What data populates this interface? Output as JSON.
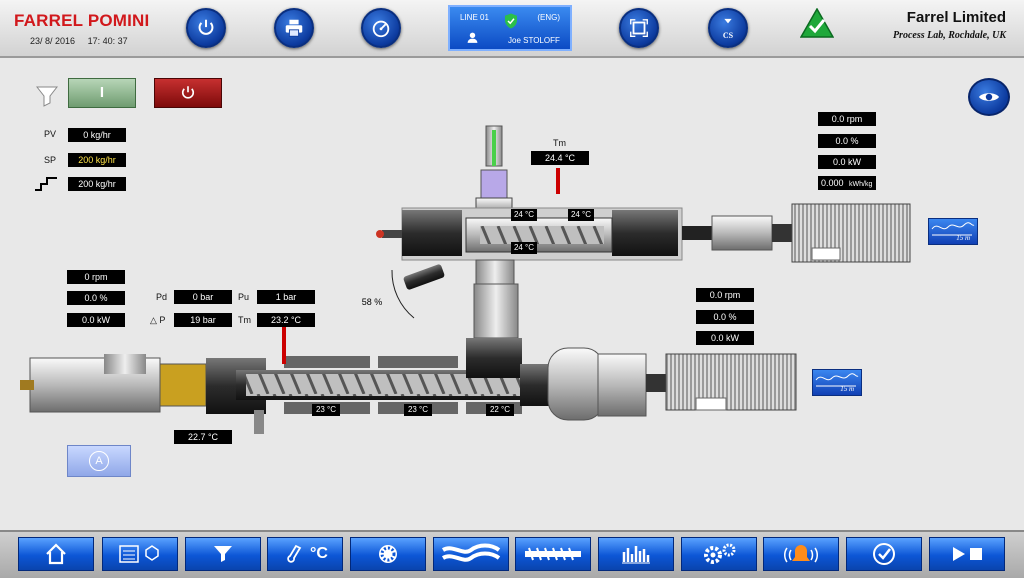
{
  "header": {
    "brand": "FARREL POMINI",
    "date": "23/ 8/ 2016",
    "time": "17: 40: 37",
    "line": "LINE 01",
    "lang": "(ENG)",
    "user": "Joe STOLOFF",
    "company": "Farrel Limited",
    "location": "Process Lab, Rochdale, UK",
    "icons": [
      "power-icon",
      "printer-icon",
      "speedometer-icon",
      "shield-check-icon",
      "fullscreen-icon",
      "hourglass-cs-icon",
      "alarm-ok-icon"
    ],
    "cs_label": "CS"
  },
  "feeder": {
    "start_label": "I",
    "pv_label": "PV",
    "pv": "0 kg/hr",
    "sp_label": "SP",
    "sp": "200 kg/hr",
    "ramp": "200 kg/hr"
  },
  "mixer": {
    "tm_label": "Tm",
    "tm": "24.4 °C",
    "rpm": "0.0 rpm",
    "pct": "0.0 %",
    "kw": "0.0 kW",
    "kwh": "0.000",
    "kwh_unit": "kWh/kg",
    "t1": "24 °C",
    "t2": "24 °C",
    "t3": "24 °C",
    "gate": "58 %",
    "trend": "15 m"
  },
  "extruder": {
    "rpm": "0 rpm",
    "pct": "0.0 %",
    "kw": "0.0 kW",
    "pd_label": "Pd",
    "pd": "0 bar",
    "pu_label": "Pu",
    "pu": "1 bar",
    "dp_label": "△ P",
    "dp": "19 bar",
    "tm_label": "Tm",
    "tm": "23.2 °C",
    "z1": "23 °C",
    "z2": "23 °C",
    "z3": "22 °C",
    "die_temp": "22.7 °C",
    "auto_label": "A"
  },
  "drive": {
    "rpm": "0.0 rpm",
    "pct": "0.0 %",
    "kw": "0.0 kW",
    "trend": "15 m"
  },
  "nav": {
    "buttons": [
      "home",
      "recipe",
      "feeder",
      "temperature",
      "mixer",
      "screws",
      "extruder",
      "trends",
      "settings",
      "alarms",
      "acknowledge",
      "sequence"
    ],
    "temp_unit": "°C"
  },
  "colors": {
    "accent": "#0c56d6",
    "brand": "#d1181c",
    "display_bg": "#000000",
    "alarm_ok": "#1fa83a"
  }
}
